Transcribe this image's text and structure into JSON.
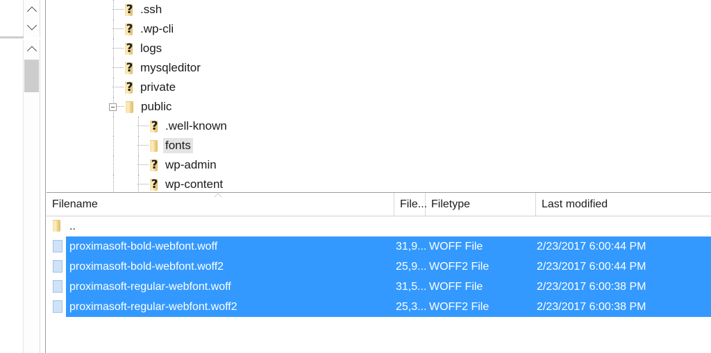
{
  "app": {
    "kind": "ftp-client-file-browser"
  },
  "scrollbars": {
    "upper_pane": {
      "up_icon": "chevron-up-icon",
      "down_icon": "chevron-down-icon"
    },
    "tree_pane": {
      "up_icon": "chevron-up-icon"
    }
  },
  "tree": {
    "items": [
      {
        "label": ".ssh",
        "depth": 1,
        "icon": "folder-unknown-icon",
        "expander": "none",
        "selected": false
      },
      {
        "label": ".wp-cli",
        "depth": 1,
        "icon": "folder-unknown-icon",
        "expander": "none",
        "selected": false
      },
      {
        "label": "logs",
        "depth": 1,
        "icon": "folder-unknown-icon",
        "expander": "none",
        "selected": false
      },
      {
        "label": "mysqleditor",
        "depth": 1,
        "icon": "folder-unknown-icon",
        "expander": "none",
        "selected": false
      },
      {
        "label": "private",
        "depth": 1,
        "icon": "folder-unknown-icon",
        "expander": "none",
        "selected": false
      },
      {
        "label": "public",
        "depth": 1,
        "icon": "folder-open-icon",
        "expander": "minus",
        "selected": false
      },
      {
        "label": ".well-known",
        "depth": 2,
        "icon": "folder-unknown-icon",
        "expander": "none",
        "selected": false
      },
      {
        "label": "fonts",
        "depth": 2,
        "icon": "folder-icon",
        "expander": "none",
        "selected": true
      },
      {
        "label": "wp-admin",
        "depth": 2,
        "icon": "folder-unknown-icon",
        "expander": "none",
        "selected": false
      },
      {
        "label": "wp-content",
        "depth": 2,
        "icon": "folder-unknown-icon",
        "expander": "none",
        "selected": false
      }
    ]
  },
  "file_list": {
    "sort_indicator": "sort-ascending-icon",
    "columns": [
      {
        "key": "filename",
        "label": "Filename"
      },
      {
        "key": "filesize",
        "label": "File..."
      },
      {
        "key": "filetype",
        "label": "Filetype"
      },
      {
        "key": "modified",
        "label": "Last modified"
      }
    ],
    "rows": [
      {
        "filename": "..",
        "filesize": "",
        "filetype": "",
        "modified": "",
        "icon": "folder-icon",
        "selected": false
      },
      {
        "filename": "proximasoft-bold-webfont.woff",
        "filesize": "31,9...",
        "filetype": "WOFF File",
        "modified": "2/23/2017 6:00:44 PM",
        "icon": "document-icon",
        "selected": true
      },
      {
        "filename": "proximasoft-bold-webfont.woff2",
        "filesize": "25,9...",
        "filetype": "WOFF2 File",
        "modified": "2/23/2017 6:00:44 PM",
        "icon": "document-icon",
        "selected": true
      },
      {
        "filename": "proximasoft-regular-webfont.woff",
        "filesize": "31,5...",
        "filetype": "WOFF File",
        "modified": "2/23/2017 6:00:38 PM",
        "icon": "document-icon",
        "selected": true
      },
      {
        "filename": "proximasoft-regular-webfont.woff2",
        "filesize": "25,3...",
        "filetype": "WOFF2 File",
        "modified": "2/23/2017 6:00:38 PM",
        "icon": "document-icon",
        "selected": true
      }
    ]
  },
  "colors": {
    "selection_blue": "#3399ff",
    "tree_selection_gray": "#e4e4e4",
    "folder_yellow": "#edcf82",
    "document_blue": "#cfe2f7",
    "pane_border": "#9b9b9b"
  }
}
